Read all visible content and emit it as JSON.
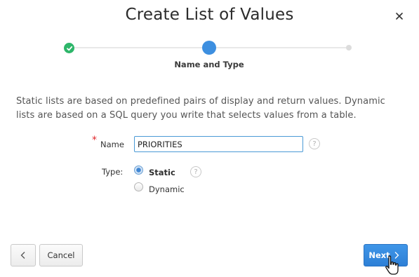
{
  "dialog": {
    "title": "Create List of Values",
    "close_symbol": "×"
  },
  "wizard": {
    "current_step_label": "Name and Type",
    "steps": [
      {
        "state": "complete",
        "icon": "check-icon"
      },
      {
        "state": "current"
      },
      {
        "state": "upcoming"
      }
    ]
  },
  "description": "Static lists are based on predefined pairs of display and return values. Dynamic lists are based on a SQL query you write that selects values from a table.",
  "form": {
    "name": {
      "required_mark": "*",
      "label": "Name",
      "value": "PRIORITIES",
      "help_symbol": "?"
    },
    "type": {
      "label": "Type:",
      "options": [
        "Static",
        "Dynamic"
      ],
      "selected": "Static",
      "help_symbol": "?"
    }
  },
  "buttons": {
    "back_symbol": "‹",
    "cancel": "Cancel",
    "next": "Next"
  },
  "colors": {
    "complete": "#2eb66a",
    "current": "#3d8fe0",
    "primary_button": "#3287de",
    "required": "#e0282c"
  }
}
